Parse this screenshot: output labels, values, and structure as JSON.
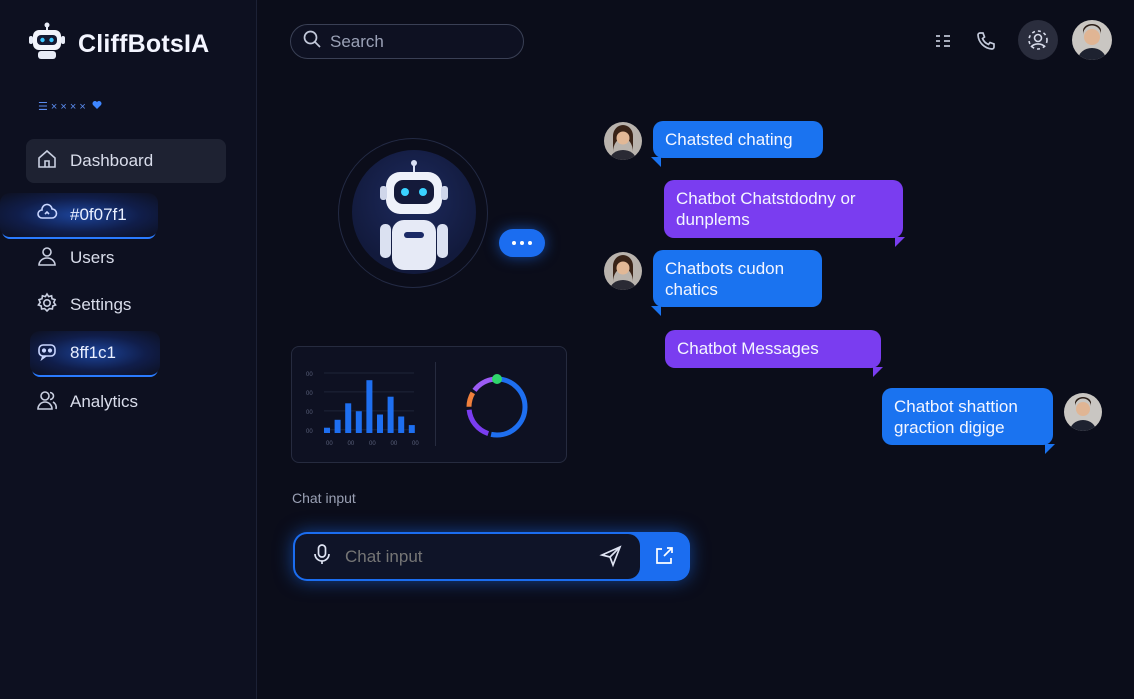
{
  "app": {
    "title": "CliffBotsIA"
  },
  "sidebar": {
    "mini_row": "☰ × × × ×",
    "items": [
      {
        "label": "Dashboard",
        "icon": "home-icon"
      },
      {
        "label": "#0f07f1",
        "icon": "cloud-sync-icon"
      },
      {
        "label": "Users",
        "icon": "user-icon"
      },
      {
        "label": "Settings",
        "icon": "gear-icon"
      },
      {
        "label": "8ff1c1",
        "icon": "chat-bot-icon"
      },
      {
        "label": "Analytics",
        "icon": "users-icon"
      }
    ]
  },
  "header": {
    "search_placeholder": "Search",
    "icons": [
      "list-icon",
      "phone-icon",
      "profile-icon"
    ]
  },
  "messages": [
    {
      "from": "user",
      "text": "Chatsted chating"
    },
    {
      "from": "bot",
      "text": "Chatbot  Chatstdodny or dunplems"
    },
    {
      "from": "user",
      "text": "Chatbots cudon chatics"
    },
    {
      "from": "bot",
      "text": "Chatbot Messages"
    },
    {
      "from": "me",
      "text": "Chatbot shattion graction digige"
    }
  ],
  "analytics": {
    "y_ticks": [
      "00",
      "00",
      "00",
      "00"
    ],
    "x_ticks": [
      "00",
      "00",
      "00",
      "00",
      "00"
    ],
    "bar_values": [
      0.08,
      0.2,
      0.45,
      0.33,
      0.8,
      0.28,
      0.55,
      0.25,
      0.12
    ],
    "ring_segments": [
      {
        "color": "#1e6ff0",
        "value": 0.55
      },
      {
        "color": "#7a3df0",
        "value": 0.2
      },
      {
        "color": "#f0803c",
        "value": 0.1
      },
      {
        "color": "#9b5bf5",
        "value": 0.15
      }
    ]
  },
  "chat": {
    "label": "Chat input",
    "placeholder": "Chat input"
  },
  "colors": {
    "accent": "#1a73f0",
    "purple": "#7a3df0",
    "background": "#0b0d1a"
  }
}
